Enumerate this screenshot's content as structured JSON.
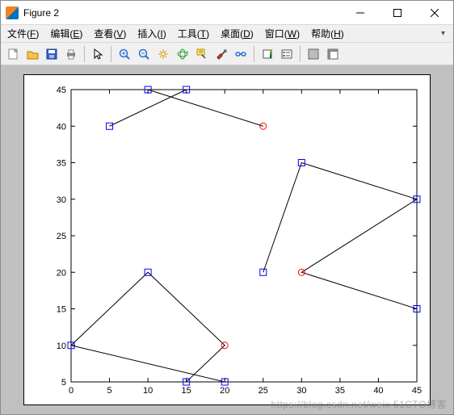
{
  "window": {
    "title": "Figure 2"
  },
  "menus": [
    {
      "label": "文件",
      "hot": "F"
    },
    {
      "label": "编辑",
      "hot": "E"
    },
    {
      "label": "查看",
      "hot": "V"
    },
    {
      "label": "插入",
      "hot": "I"
    },
    {
      "label": "工具",
      "hot": "T"
    },
    {
      "label": "桌面",
      "hot": "D"
    },
    {
      "label": "窗口",
      "hot": "W"
    },
    {
      "label": "帮助",
      "hot": "H"
    }
  ],
  "toolbar_icons": [
    "new-figure",
    "open-file",
    "save",
    "print",
    "|",
    "pointer",
    "|",
    "zoom-in",
    "zoom-out",
    "pan",
    "rotate3d",
    "data-cursor",
    "brush",
    "link-data",
    "|",
    "insert-colorbar",
    "insert-legend",
    "|",
    "hide-tools",
    "show-tools"
  ],
  "chart_data": {
    "type": "scatter",
    "xlabel": "",
    "ylabel": "",
    "title": "",
    "xlim": [
      0,
      45
    ],
    "ylim": [
      5,
      45
    ],
    "xticks": [
      0,
      5,
      10,
      15,
      20,
      25,
      30,
      35,
      40,
      45
    ],
    "yticks": [
      5,
      10,
      15,
      20,
      25,
      30,
      35,
      40,
      45
    ],
    "polylines": [
      {
        "pts": [
          [
            5,
            40
          ],
          [
            15,
            45
          ],
          [
            10,
            45
          ],
          [
            25,
            40
          ]
        ]
      },
      {
        "pts": [
          [
            0,
            10
          ],
          [
            10,
            20
          ],
          [
            20,
            10
          ],
          [
            15,
            5
          ],
          [
            20,
            5
          ],
          [
            0,
            10
          ]
        ]
      },
      {
        "pts": [
          [
            25,
            20
          ],
          [
            30,
            35
          ],
          [
            45,
            30
          ],
          [
            30,
            20
          ],
          [
            45,
            15
          ]
        ]
      }
    ],
    "markers_square_blue": [
      [
        5,
        40
      ],
      [
        15,
        45
      ],
      [
        10,
        45
      ],
      [
        0,
        10
      ],
      [
        10,
        20
      ],
      [
        15,
        5
      ],
      [
        20,
        5
      ],
      [
        25,
        20
      ],
      [
        30,
        35
      ],
      [
        45,
        30
      ],
      [
        45,
        15
      ]
    ],
    "markers_circle_red": [
      [
        25,
        40
      ],
      [
        20,
        10
      ],
      [
        30,
        20
      ]
    ]
  },
  "watermark": "https://blog.csdn.net/weix  51CTO博客",
  "colors": {
    "axis": "#000000",
    "square_stroke": "#0000ff",
    "circle_stroke": "#ff0000",
    "line": "#000000"
  }
}
